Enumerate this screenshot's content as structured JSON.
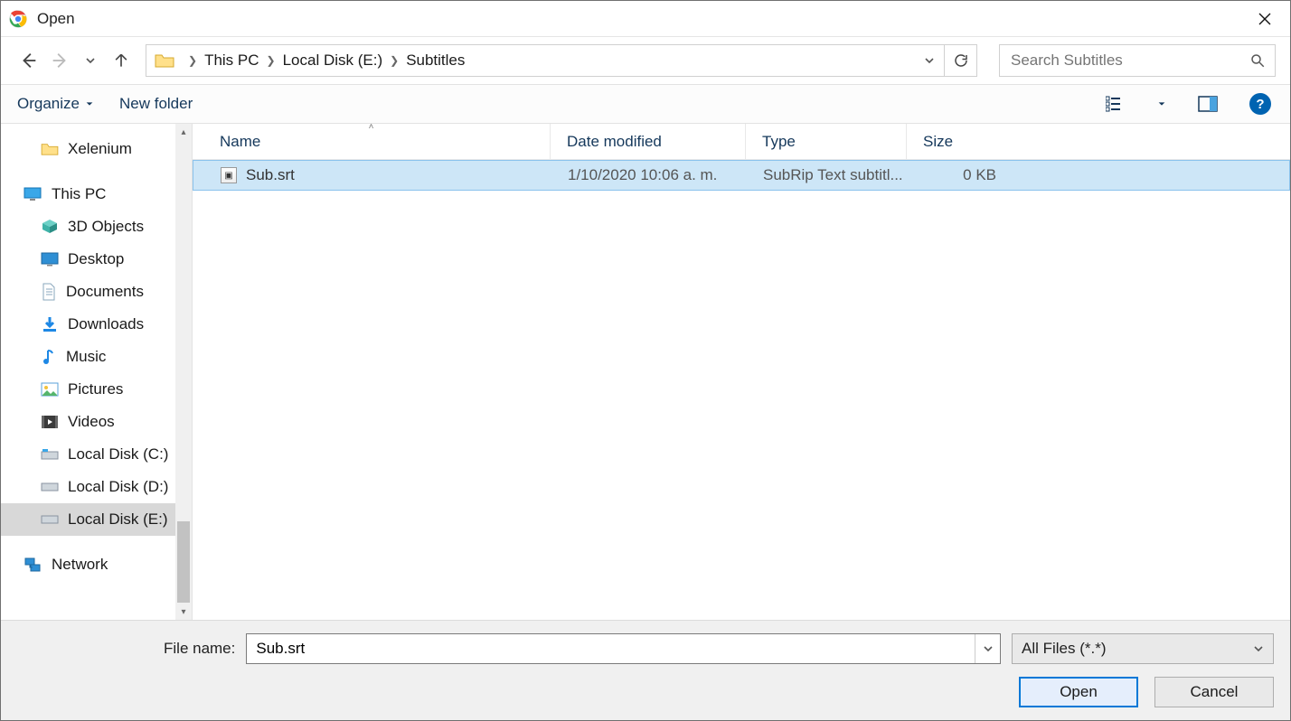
{
  "title": "Open",
  "breadcrumb": {
    "root": "This PC",
    "disk": "Local Disk (E:)",
    "folder": "Subtitles"
  },
  "search": {
    "placeholder": "Search Subtitles"
  },
  "toolbar": {
    "organize": "Organize",
    "newfolder": "New folder"
  },
  "columns": {
    "name": "Name",
    "date": "Date modified",
    "type": "Type",
    "size": "Size"
  },
  "tree": {
    "xelenium": "Xelenium",
    "thispc": "This PC",
    "objects3d": "3D Objects",
    "desktop": "Desktop",
    "documents": "Documents",
    "downloads": "Downloads",
    "music": "Music",
    "pictures": "Pictures",
    "videos": "Videos",
    "diskc": "Local Disk (C:)",
    "diskd": "Local Disk (D:)",
    "diske": "Local Disk (E:)",
    "network": "Network"
  },
  "files": [
    {
      "name": "Sub.srt",
      "date": "1/10/2020 10:06 a. m.",
      "type": "SubRip Text subtitl...",
      "size": "0 KB"
    }
  ],
  "footer": {
    "fnlabel": "File name:",
    "fnvalue": "Sub.srt",
    "filter": "All Files (*.*)",
    "open": "Open",
    "cancel": "Cancel"
  }
}
